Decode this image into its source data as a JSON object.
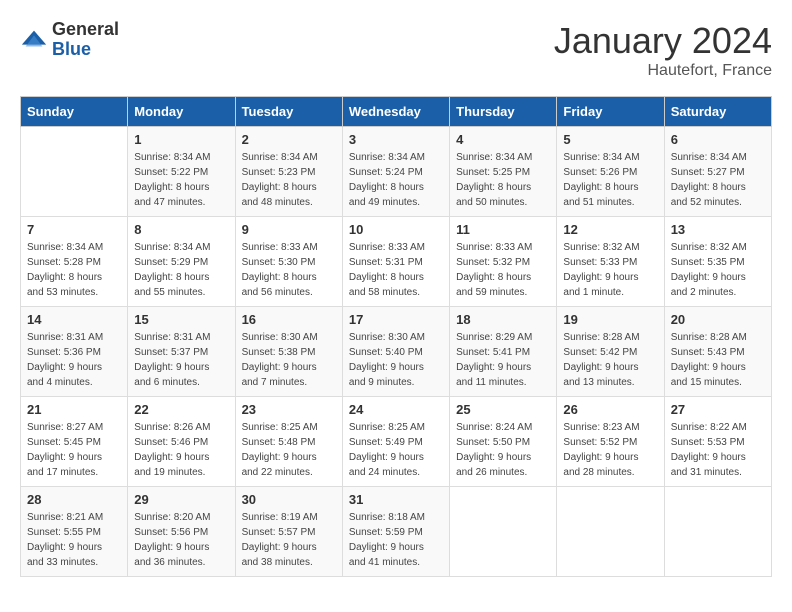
{
  "header": {
    "logo_general": "General",
    "logo_blue": "Blue",
    "month_title": "January 2024",
    "location": "Hautefort, France"
  },
  "weekdays": [
    "Sunday",
    "Monday",
    "Tuesday",
    "Wednesday",
    "Thursday",
    "Friday",
    "Saturday"
  ],
  "weeks": [
    [
      {
        "day": "",
        "sunrise": "",
        "sunset": "",
        "daylight": ""
      },
      {
        "day": "1",
        "sunrise": "Sunrise: 8:34 AM",
        "sunset": "Sunset: 5:22 PM",
        "daylight": "Daylight: 8 hours and 47 minutes."
      },
      {
        "day": "2",
        "sunrise": "Sunrise: 8:34 AM",
        "sunset": "Sunset: 5:23 PM",
        "daylight": "Daylight: 8 hours and 48 minutes."
      },
      {
        "day": "3",
        "sunrise": "Sunrise: 8:34 AM",
        "sunset": "Sunset: 5:24 PM",
        "daylight": "Daylight: 8 hours and 49 minutes."
      },
      {
        "day": "4",
        "sunrise": "Sunrise: 8:34 AM",
        "sunset": "Sunset: 5:25 PM",
        "daylight": "Daylight: 8 hours and 50 minutes."
      },
      {
        "day": "5",
        "sunrise": "Sunrise: 8:34 AM",
        "sunset": "Sunset: 5:26 PM",
        "daylight": "Daylight: 8 hours and 51 minutes."
      },
      {
        "day": "6",
        "sunrise": "Sunrise: 8:34 AM",
        "sunset": "Sunset: 5:27 PM",
        "daylight": "Daylight: 8 hours and 52 minutes."
      }
    ],
    [
      {
        "day": "7",
        "sunrise": "Sunrise: 8:34 AM",
        "sunset": "Sunset: 5:28 PM",
        "daylight": "Daylight: 8 hours and 53 minutes."
      },
      {
        "day": "8",
        "sunrise": "Sunrise: 8:34 AM",
        "sunset": "Sunset: 5:29 PM",
        "daylight": "Daylight: 8 hours and 55 minutes."
      },
      {
        "day": "9",
        "sunrise": "Sunrise: 8:33 AM",
        "sunset": "Sunset: 5:30 PM",
        "daylight": "Daylight: 8 hours and 56 minutes."
      },
      {
        "day": "10",
        "sunrise": "Sunrise: 8:33 AM",
        "sunset": "Sunset: 5:31 PM",
        "daylight": "Daylight: 8 hours and 58 minutes."
      },
      {
        "day": "11",
        "sunrise": "Sunrise: 8:33 AM",
        "sunset": "Sunset: 5:32 PM",
        "daylight": "Daylight: 8 hours and 59 minutes."
      },
      {
        "day": "12",
        "sunrise": "Sunrise: 8:32 AM",
        "sunset": "Sunset: 5:33 PM",
        "daylight": "Daylight: 9 hours and 1 minute."
      },
      {
        "day": "13",
        "sunrise": "Sunrise: 8:32 AM",
        "sunset": "Sunset: 5:35 PM",
        "daylight": "Daylight: 9 hours and 2 minutes."
      }
    ],
    [
      {
        "day": "14",
        "sunrise": "Sunrise: 8:31 AM",
        "sunset": "Sunset: 5:36 PM",
        "daylight": "Daylight: 9 hours and 4 minutes."
      },
      {
        "day": "15",
        "sunrise": "Sunrise: 8:31 AM",
        "sunset": "Sunset: 5:37 PM",
        "daylight": "Daylight: 9 hours and 6 minutes."
      },
      {
        "day": "16",
        "sunrise": "Sunrise: 8:30 AM",
        "sunset": "Sunset: 5:38 PM",
        "daylight": "Daylight: 9 hours and 7 minutes."
      },
      {
        "day": "17",
        "sunrise": "Sunrise: 8:30 AM",
        "sunset": "Sunset: 5:40 PM",
        "daylight": "Daylight: 9 hours and 9 minutes."
      },
      {
        "day": "18",
        "sunrise": "Sunrise: 8:29 AM",
        "sunset": "Sunset: 5:41 PM",
        "daylight": "Daylight: 9 hours and 11 minutes."
      },
      {
        "day": "19",
        "sunrise": "Sunrise: 8:28 AM",
        "sunset": "Sunset: 5:42 PM",
        "daylight": "Daylight: 9 hours and 13 minutes."
      },
      {
        "day": "20",
        "sunrise": "Sunrise: 8:28 AM",
        "sunset": "Sunset: 5:43 PM",
        "daylight": "Daylight: 9 hours and 15 minutes."
      }
    ],
    [
      {
        "day": "21",
        "sunrise": "Sunrise: 8:27 AM",
        "sunset": "Sunset: 5:45 PM",
        "daylight": "Daylight: 9 hours and 17 minutes."
      },
      {
        "day": "22",
        "sunrise": "Sunrise: 8:26 AM",
        "sunset": "Sunset: 5:46 PM",
        "daylight": "Daylight: 9 hours and 19 minutes."
      },
      {
        "day": "23",
        "sunrise": "Sunrise: 8:25 AM",
        "sunset": "Sunset: 5:48 PM",
        "daylight": "Daylight: 9 hours and 22 minutes."
      },
      {
        "day": "24",
        "sunrise": "Sunrise: 8:25 AM",
        "sunset": "Sunset: 5:49 PM",
        "daylight": "Daylight: 9 hours and 24 minutes."
      },
      {
        "day": "25",
        "sunrise": "Sunrise: 8:24 AM",
        "sunset": "Sunset: 5:50 PM",
        "daylight": "Daylight: 9 hours and 26 minutes."
      },
      {
        "day": "26",
        "sunrise": "Sunrise: 8:23 AM",
        "sunset": "Sunset: 5:52 PM",
        "daylight": "Daylight: 9 hours and 28 minutes."
      },
      {
        "day": "27",
        "sunrise": "Sunrise: 8:22 AM",
        "sunset": "Sunset: 5:53 PM",
        "daylight": "Daylight: 9 hours and 31 minutes."
      }
    ],
    [
      {
        "day": "28",
        "sunrise": "Sunrise: 8:21 AM",
        "sunset": "Sunset: 5:55 PM",
        "daylight": "Daylight: 9 hours and 33 minutes."
      },
      {
        "day": "29",
        "sunrise": "Sunrise: 8:20 AM",
        "sunset": "Sunset: 5:56 PM",
        "daylight": "Daylight: 9 hours and 36 minutes."
      },
      {
        "day": "30",
        "sunrise": "Sunrise: 8:19 AM",
        "sunset": "Sunset: 5:57 PM",
        "daylight": "Daylight: 9 hours and 38 minutes."
      },
      {
        "day": "31",
        "sunrise": "Sunrise: 8:18 AM",
        "sunset": "Sunset: 5:59 PM",
        "daylight": "Daylight: 9 hours and 41 minutes."
      },
      {
        "day": "",
        "sunrise": "",
        "sunset": "",
        "daylight": ""
      },
      {
        "day": "",
        "sunrise": "",
        "sunset": "",
        "daylight": ""
      },
      {
        "day": "",
        "sunrise": "",
        "sunset": "",
        "daylight": ""
      }
    ]
  ]
}
